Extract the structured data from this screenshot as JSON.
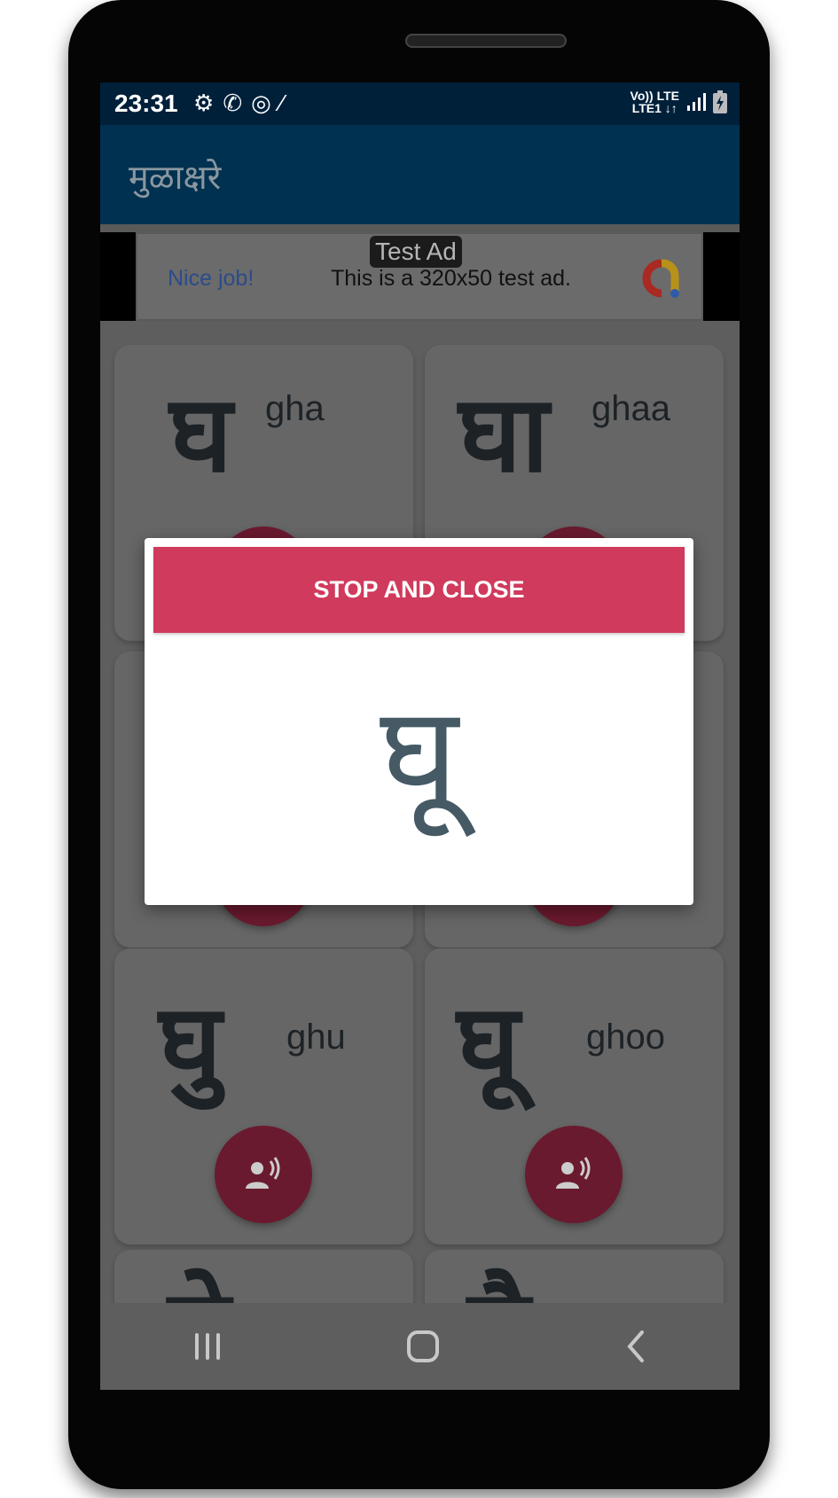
{
  "status_bar": {
    "time": "23:31",
    "icons": [
      "gear-icon",
      "whatsapp-icon",
      "hotspot-icon",
      "magic-wand-icon"
    ],
    "network_top": "Vo)) LTE",
    "network_bottom": "LTE1 ↓↑"
  },
  "app_bar": {
    "title": "मुळाक्षरे"
  },
  "ad": {
    "badge": "Test Ad",
    "headline": "Nice job!",
    "text": "This is a 320x50 test ad."
  },
  "cards": [
    {
      "glyph": "घ",
      "label": "gha"
    },
    {
      "glyph": "घा",
      "label": "ghaa"
    },
    {
      "glyph": "",
      "label": ""
    },
    {
      "glyph": "",
      "label": ""
    },
    {
      "glyph": "घु",
      "label": "ghu"
    },
    {
      "glyph": "घू",
      "label": "ghoo"
    },
    {
      "glyph": "घे",
      "label": ""
    },
    {
      "glyph": "घै",
      "label": ""
    }
  ],
  "dialog": {
    "button_label": "STOP AND CLOSE",
    "character": "घू"
  },
  "colors": {
    "accent": "#d03a5c",
    "app_bar": "#003150",
    "status_bar": "#00203a",
    "dialog_char": "#455a64"
  }
}
